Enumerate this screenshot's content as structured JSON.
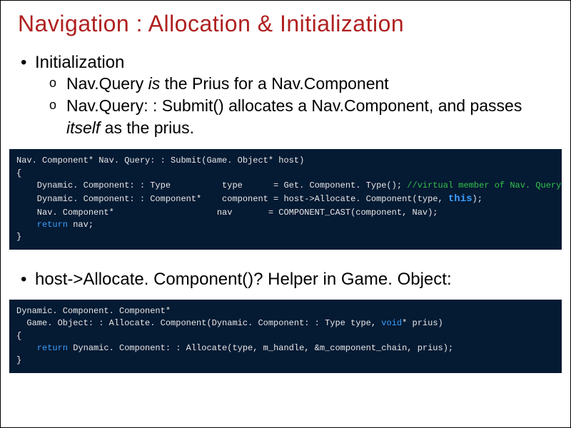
{
  "title": "Navigation : Allocation & Initialization",
  "bullets": {
    "b1": {
      "head": "Initialization",
      "sub": {
        "s1_a": "Nav.Query ",
        "s1_is": "is",
        "s1_b": " the Prius for a Nav.Component",
        "s2_a": "Nav.Query: : Submit() allocates a Nav.Component, and passes ",
        "s2_itself": "itself",
        "s2_b": " as the prius."
      }
    },
    "b2": "host->Allocate. Component()?  Helper in Game. Object:"
  },
  "code1": {
    "l1": "Nav. Component* Nav. Query: : Submit(Game. Object* host)",
    "l2": "{",
    "l3a": "    Dynamic. Component: : Type          type      = Get. Component. Type(); ",
    "l3cmt": "//virtual member of Nav. Query",
    "l4a": "    Dynamic. Component: : Component*    component = host->Allocate. Component(type, ",
    "l4this": "this",
    "l4b": ");",
    "l5": "    Nav. Component*                    nav       = COMPONENT_CAST(component, Nav);",
    "l6kw": "    return",
    "l6b": " nav;",
    "l7": "}"
  },
  "code2": {
    "l1": "Dynamic. Component. Component*",
    "l2a": "  Game. Object: : Allocate. Component(Dynamic. Component: : Type type, ",
    "l2kw": "void",
    "l2b": "* prius)",
    "l3": "{",
    "l4kw": "    return",
    "l4b": " Dynamic. Component: : Allocate(type, m_handle, &m_component_chain, prius);",
    "l5": "}"
  }
}
